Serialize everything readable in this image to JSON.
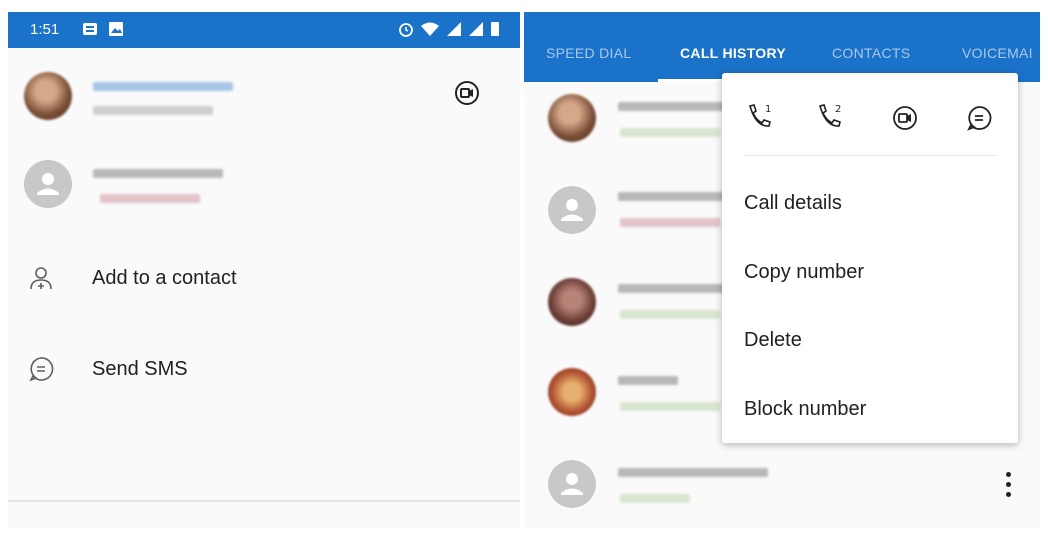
{
  "left": {
    "status": {
      "time": "1:51"
    },
    "actions": [
      {
        "label": "Add to a contact"
      },
      {
        "label": "Send SMS"
      }
    ]
  },
  "right": {
    "tabs": [
      {
        "label": "SPEED DIAL"
      },
      {
        "label": "CALL HISTORY"
      },
      {
        "label": "CONTACTS"
      },
      {
        "label": "VOICEMAI"
      }
    ],
    "menu": {
      "icons": [
        "call-sim-1-icon",
        "call-sim-2-icon",
        "video-call-icon",
        "message-icon"
      ],
      "sim1_badge": "1",
      "sim2_badge": "2",
      "items": [
        {
          "label": "Call details"
        },
        {
          "label": "Copy number"
        },
        {
          "label": "Delete"
        },
        {
          "label": "Block number"
        }
      ]
    }
  },
  "colors": {
    "accent": "#1a72c9",
    "text": "#212121",
    "icon": "#5f5f5f"
  }
}
